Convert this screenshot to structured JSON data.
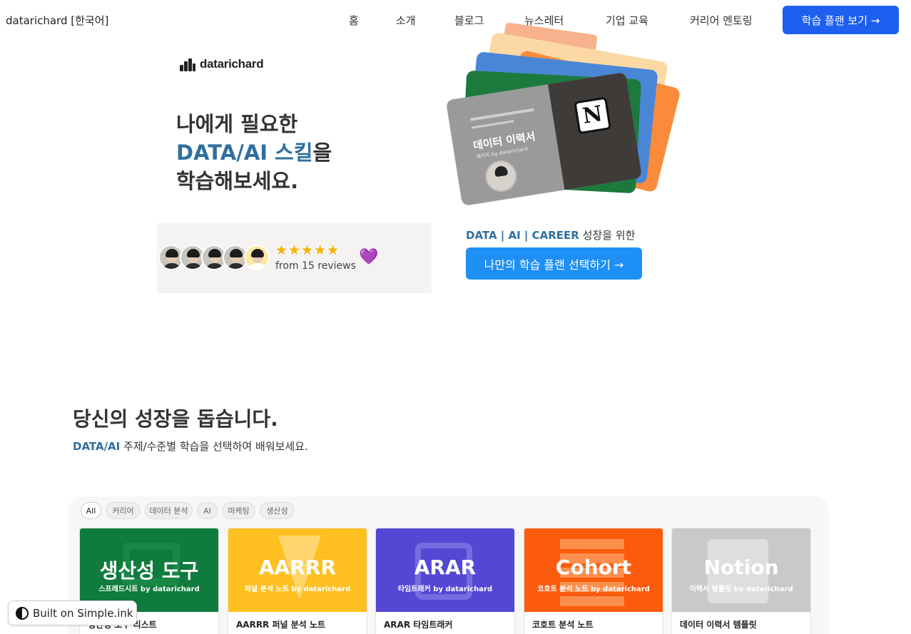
{
  "header": {
    "site_title": "datarichard [한국어]",
    "nav": [
      "홈",
      "소개",
      "블로그",
      "뉴스레터",
      "기업 교육",
      "커리어 멘토링"
    ],
    "cta_label": "학습 플랜 보기 →"
  },
  "hero": {
    "logo_text": "datarichard",
    "heading_line1": "나에게 필요한",
    "heading_accent": "DATA/AI 스킬",
    "heading_line2_suffix": "을",
    "heading_line3": "학습해보세요.",
    "card": {
      "title": "데이터 이력서",
      "subtitle": "패키지 by datarichard",
      "notion_glyph": "N"
    }
  },
  "reviews": {
    "stars": "★★★★★",
    "count_text": "from 15 reviews",
    "heart": "💜"
  },
  "cta": {
    "caption_accent": "DATA | AI | CAREER",
    "caption_rest": " 성장을 위한",
    "button_label": "나만의 학습 플랜 선택하기 →"
  },
  "section": {
    "title": "당신의 성장을 돕습니다.",
    "subtitle_accent": "DATA/AI",
    "subtitle_rest": " 주제/수준별 학습을 선택하여 배워보세요."
  },
  "filters": [
    "All",
    "커리어",
    "데이터 분석",
    "AI",
    "마케팅",
    "생산성"
  ],
  "products": [
    {
      "thumb_title": "생산성 도구",
      "thumb_sub": "스프레드시트 by datarichard",
      "name": "생산성 도구 리스트",
      "color": "#0f7b3c"
    },
    {
      "thumb_title": "AARRR",
      "thumb_sub": "퍼널 분석 노트 by datarichard",
      "name": "AARRR 퍼널 분석 노트",
      "color": "#fdc020"
    },
    {
      "thumb_title": "ARAR",
      "thumb_sub": "타임트래커 by datarichard",
      "name": "ARAR 타임트래커",
      "color": "#5447d4"
    },
    {
      "thumb_title": "Cohort",
      "thumb_sub": "코호트 분석 노트 by datarichard",
      "name": "코호트 분석 노트",
      "color": "#fb5b0c"
    },
    {
      "thumb_title": "Notion",
      "thumb_sub": "이력서 템플릿 by datarichard",
      "name": "데이터 이력서 템플릿",
      "color": "#c9c9c9"
    }
  ],
  "badge": {
    "label": "Built on Simple.ink"
  }
}
